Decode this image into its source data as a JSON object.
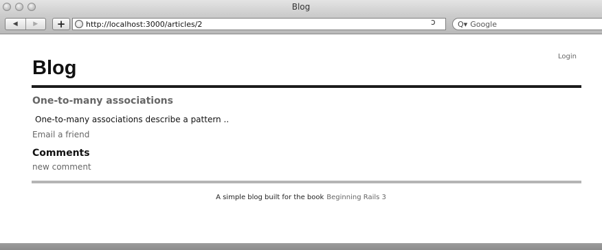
{
  "window": {
    "title": "Blog"
  },
  "toolbar": {
    "back_icon": "◀",
    "forward_icon": "▶",
    "add_bookmark_icon": "+",
    "url": "http://localhost:3000/articles/2",
    "reload_icon": "ↄ",
    "search_icon": "Q▾",
    "search_placeholder": "Google"
  },
  "header": {
    "login_label": "Login",
    "site_title": "Blog"
  },
  "article": {
    "title": "One-to-many associations",
    "body": "One-to-many associations describe a pattern ..",
    "email_link": "Email a friend"
  },
  "comments": {
    "heading": "Comments",
    "new_comment_link": "new comment"
  },
  "footer": {
    "text": "A simple blog built for the book",
    "book_link": "Beginning Rails 3"
  },
  "colors": {
    "link": "#666666",
    "rule_dark": "#1c1c1c",
    "rule_light": "#b5b5b5"
  }
}
